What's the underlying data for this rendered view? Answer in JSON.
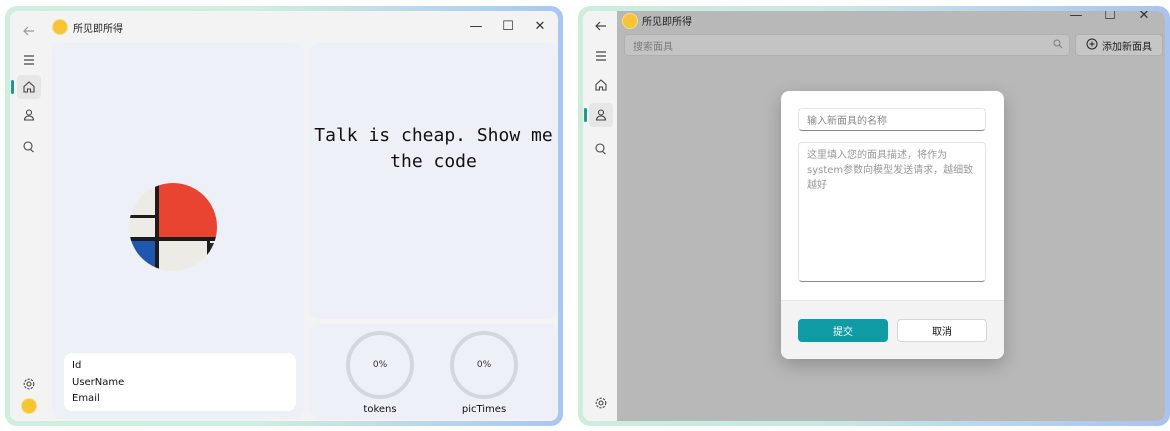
{
  "left_window": {
    "title": "所见即所得",
    "quote": "Talk is cheap. Show me the code",
    "user": {
      "id_label": "Id",
      "username_label": "UserName",
      "email_label": "Email"
    },
    "stats": [
      {
        "label": "tokens",
        "value": "0%"
      },
      {
        "label": "picTimes",
        "value": "0%"
      }
    ]
  },
  "right_window": {
    "title": "所见即所得",
    "search_placeholder": "搜索面具",
    "add_button": "添加新面具",
    "dialog": {
      "name_placeholder": "输入新面具的名称",
      "desc_placeholder": "这里填入您的面具描述，将作为system参数向模型发送请求，越细致越好",
      "submit": "提交",
      "cancel": "取消"
    }
  },
  "colors": {
    "accent": "#0f9ba4",
    "indicator": "#1a9b8f",
    "sun": "#f7c432"
  },
  "icons": [
    "back-arrow-icon",
    "menu-icon",
    "home-icon",
    "mask-icon",
    "chat-icon",
    "settings-icon",
    "search-icon",
    "add-circle-icon",
    "minimize-icon",
    "maximize-icon",
    "close-icon"
  ]
}
